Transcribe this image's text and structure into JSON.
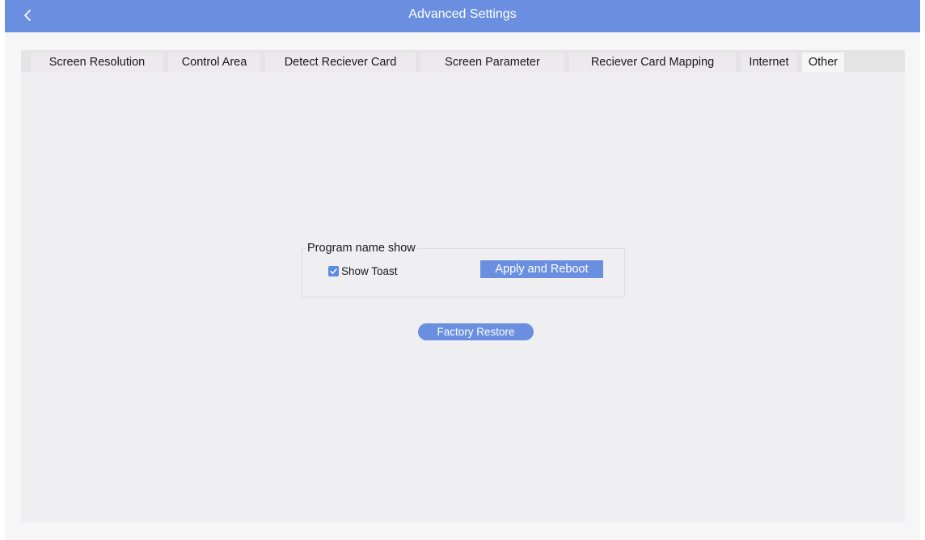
{
  "window": {
    "title": "Advanced Settings"
  },
  "tabs": [
    {
      "label": "Screen Resolution",
      "active": false
    },
    {
      "label": "Control Area",
      "active": false
    },
    {
      "label": "Detect Reciever Card",
      "active": false
    },
    {
      "label": "Screen Parameter",
      "active": false
    },
    {
      "label": "Reciever Card Mapping",
      "active": false
    },
    {
      "label": "Internet",
      "active": false
    },
    {
      "label": "Other",
      "active": true
    }
  ],
  "program_name_group": {
    "title": "Program name show",
    "show_toast_label": "Show Toast",
    "show_toast_checked": true,
    "apply_button_label": "Apply and Reboot"
  },
  "factory_restore_label": "Factory Restore",
  "colors": {
    "accent": "#6b8fe0",
    "titlebar_text": "#ffffff",
    "background": "#f7f6f7",
    "panel": "#efeef0"
  },
  "icons": {
    "back": "chevron-left-icon",
    "checkbox": "checkmark-icon"
  }
}
